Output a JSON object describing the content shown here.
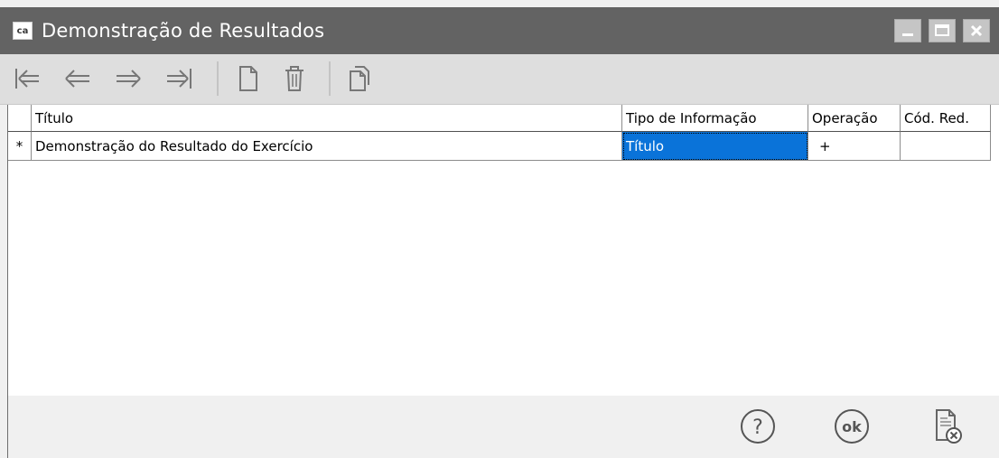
{
  "window": {
    "title": "Demonstração de Resultados",
    "app_icon_text": "ca"
  },
  "toolbar": {
    "icons": [
      "first-record-icon",
      "previous-record-icon",
      "next-record-icon",
      "last-record-icon",
      "new-document-icon",
      "delete-trash-icon",
      "copy-document-icon"
    ]
  },
  "grid": {
    "columns": [
      "Título",
      "Tipo de Informação",
      "Operação",
      "Cód. Red."
    ],
    "rows": [
      {
        "indicator": "*",
        "titulo": "Demonstração do Resultado do Exercício",
        "tipo": "Título",
        "operacao": "+",
        "cod_red": ""
      }
    ],
    "selection_color": "#0a73d9"
  },
  "actions": {
    "icons": [
      "help-icon",
      "ok-icon",
      "cancel-document-icon"
    ],
    "ok_text": "ok",
    "help_text": "?"
  }
}
